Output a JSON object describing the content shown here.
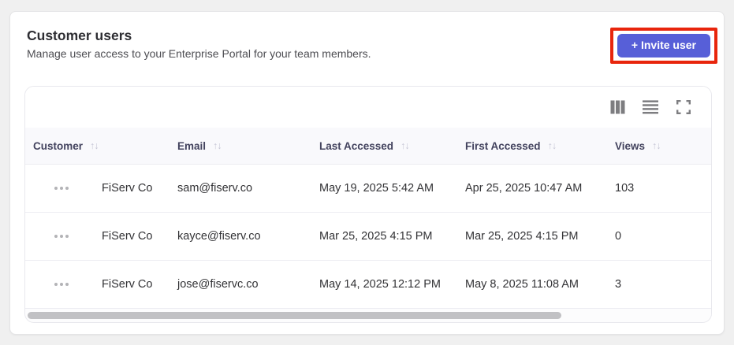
{
  "header": {
    "title": "Customer users",
    "subtitle": "Manage user access to your Enterprise Portal for your team members.",
    "invite_button_label": "+ Invite user"
  },
  "toolbar": {
    "icons": [
      "columns-icon",
      "row-density-icon",
      "fullscreen-icon"
    ]
  },
  "table": {
    "sort_glyph": "↑↓",
    "columns": [
      {
        "key": "customer",
        "label": "Customer",
        "sortable": true
      },
      {
        "key": "email",
        "label": "Email",
        "sortable": true
      },
      {
        "key": "last_accessed",
        "label": "Last Accessed",
        "sortable": true
      },
      {
        "key": "first_accessed",
        "label": "First Accessed",
        "sortable": true
      },
      {
        "key": "views",
        "label": "Views",
        "sortable": true
      }
    ],
    "rows": [
      {
        "customer": "FiServ Co",
        "email": "sam@fiserv.co",
        "last_accessed": "May 19, 2025 5:42 AM",
        "first_accessed": "Apr 25, 2025 10:47 AM",
        "views": "103"
      },
      {
        "customer": "FiServ Co",
        "email": "kayce@fiserv.co",
        "last_accessed": "Mar 25, 2025 4:15 PM",
        "first_accessed": "Mar 25, 2025 4:15 PM",
        "views": "0"
      },
      {
        "customer": "FiServ Co",
        "email": "jose@fiservc.co",
        "last_accessed": "May 14, 2025 12:12 PM",
        "first_accessed": "May 8, 2025 11:08 AM",
        "views": "3"
      }
    ]
  },
  "colors": {
    "accent": "#575fd8",
    "annotation_highlight": "#e8250c",
    "header_bg": "#f9f9fc"
  }
}
